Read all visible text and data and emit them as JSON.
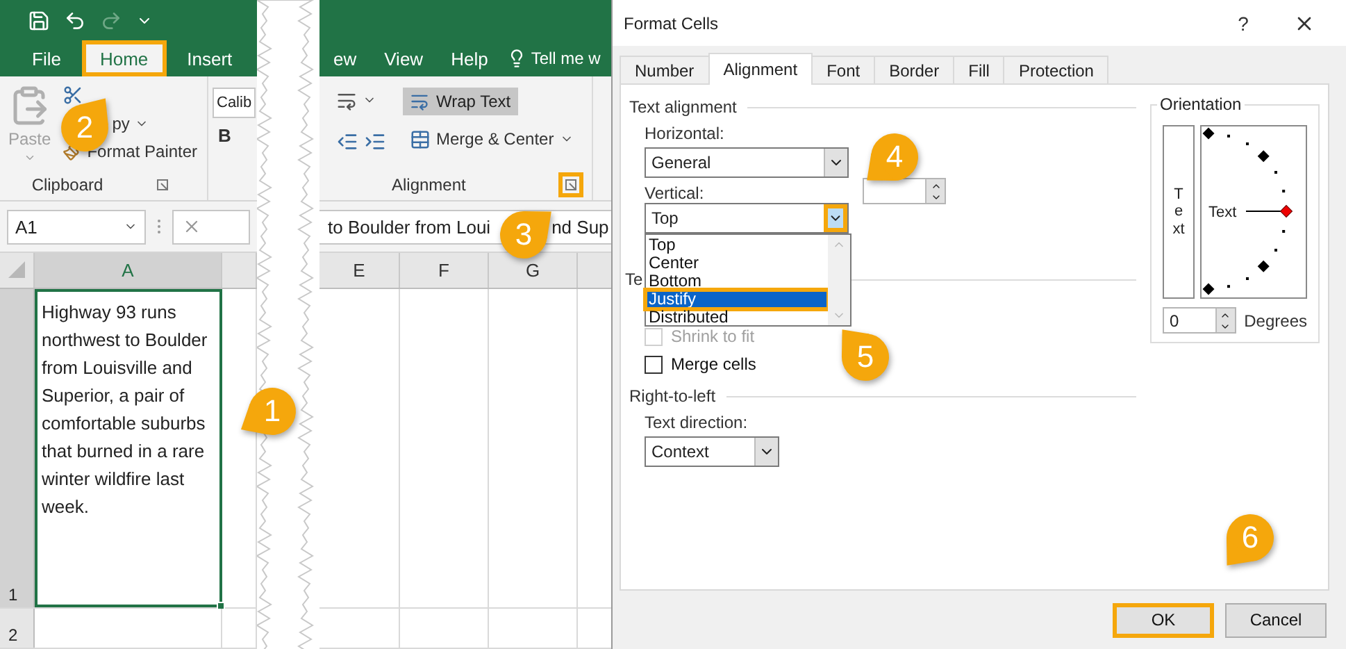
{
  "excel": {
    "ribbon_tabs": [
      {
        "label": "File",
        "selected": false,
        "highlighted": false
      },
      {
        "label": "Home",
        "selected": true,
        "highlighted": true
      },
      {
        "label": "Insert",
        "selected": false,
        "highlighted": false
      }
    ],
    "ribbon_tabs_right": [
      {
        "label": "ew",
        "selected": false
      },
      {
        "label": "View",
        "selected": false
      },
      {
        "label": "Help",
        "selected": false
      }
    ],
    "tell_me": "Tell me w",
    "clipboard": {
      "paste": "Paste",
      "paste_disabled": true,
      "copy": "py",
      "format_painter": "Format Painter",
      "group_label": "Clipboard"
    },
    "font": {
      "name": "Calib",
      "bold": "B"
    },
    "alignment": {
      "wrap_text": "Wrap Text",
      "wrap_text_on": true,
      "merge": "Merge & Center",
      "group_label": "Alignment",
      "launcher_highlighted": true
    },
    "name_box": "A1",
    "formula_parts": [
      "to Boulder from Loui",
      "nd Sup"
    ],
    "columns_left": [
      "A"
    ],
    "columns_right": [
      "E",
      "F",
      "G"
    ],
    "rows": [
      "1",
      "2"
    ],
    "cell": {
      "text": "Highway 93 runs northwest to Boulder from Louisville and Superior, a pair of comfortable suburbs that burned in a rare winter wildfire last week.",
      "selected": true
    }
  },
  "dialog": {
    "title": "Format Cells",
    "help": "?",
    "tabs": [
      {
        "label": "Number",
        "selected": false
      },
      {
        "label": "Alignment",
        "selected": true
      },
      {
        "label": "Font",
        "selected": false
      },
      {
        "label": "Border",
        "selected": false
      },
      {
        "label": "Fill",
        "selected": false
      },
      {
        "label": "Protection",
        "selected": false
      }
    ],
    "text_alignment": {
      "heading": "Text alignment",
      "horizontal_label": "Horizontal:",
      "horizontal": "General",
      "vertical_label": "Vertical:",
      "vertical": "Top",
      "vertical_button_highlighted": true,
      "vertical_options": [
        {
          "label": "Top",
          "selected": false,
          "highlighted": false
        },
        {
          "label": "Center",
          "selected": false,
          "highlighted": false
        },
        {
          "label": "Bottom",
          "selected": false,
          "highlighted": false
        },
        {
          "label": "Justify",
          "selected": true,
          "highlighted": true
        },
        {
          "label": "Distributed",
          "selected": false,
          "highlighted": false
        }
      ]
    },
    "text_control": {
      "heading": "Te",
      "options": [
        {
          "label": "Shrink to fit",
          "checked": false,
          "disabled": true
        },
        {
          "label": "Merge cells",
          "checked": false,
          "disabled": false
        }
      ]
    },
    "right_to_left": {
      "heading": "Right-to-left",
      "direction_label": "Text direction:",
      "direction": "Context"
    },
    "orientation": {
      "heading": "Orientation",
      "vertical_text": "Text",
      "dial_text": "Text",
      "degrees": "0",
      "degrees_label": "Degrees"
    },
    "buttons": [
      {
        "label": "OK",
        "highlighted": true
      },
      {
        "label": "Cancel",
        "highlighted": false
      }
    ]
  },
  "callouts": [
    "1",
    "2",
    "3",
    "4",
    "5",
    "6"
  ]
}
